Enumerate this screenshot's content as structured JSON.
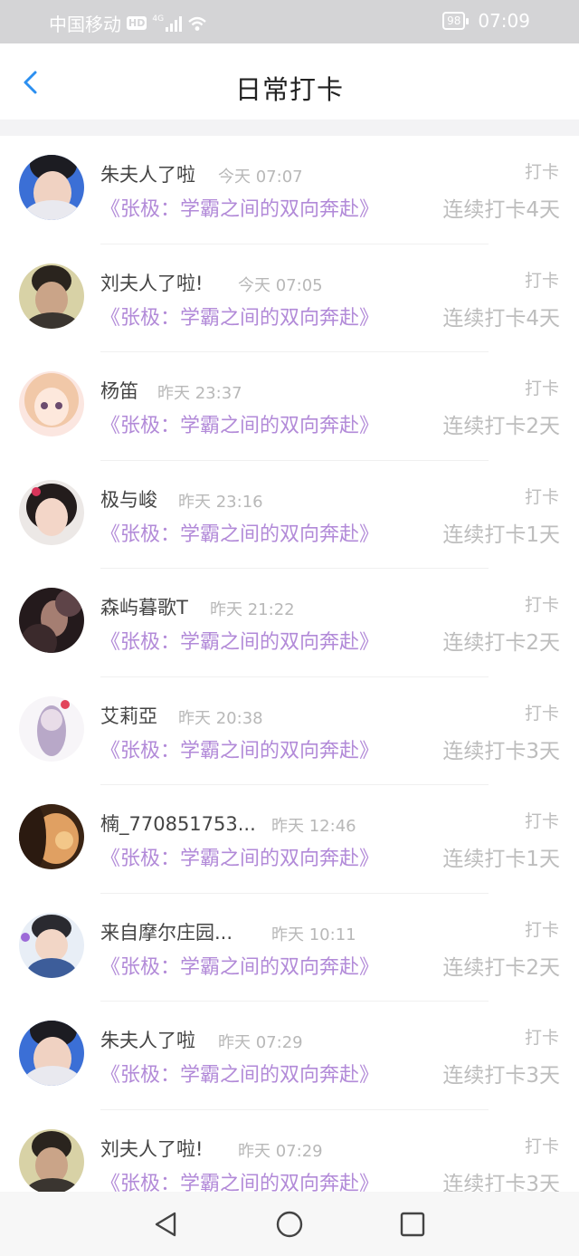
{
  "status_bar": {
    "carrier": "中国移动",
    "hd": "HD",
    "network": "4G",
    "battery": "98",
    "time": "07:09"
  },
  "header": {
    "title": "日常打卡",
    "back_icon": "chevron-left-icon"
  },
  "colors": {
    "accent_blue": "#2b8ff0",
    "book_purple": "#b28ad8",
    "muted_gray": "#bdbdbd",
    "status_bar_bg": "#d4d4d6"
  },
  "entries": [
    {
      "name": "朱夫人了啦",
      "time": "今天 07:07",
      "book": "《张极：学霸之间的双向奔赴》",
      "action": "打卡",
      "streak": "连续打卡4天"
    },
    {
      "name": "刘夫人了啦!",
      "time": "今天 07:05",
      "book": "《张极：学霸之间的双向奔赴》",
      "action": "打卡",
      "streak": "连续打卡4天"
    },
    {
      "name": "杨笛",
      "time": "昨天 23:37",
      "book": "《张极：学霸之间的双向奔赴》",
      "action": "打卡",
      "streak": "连续打卡2天"
    },
    {
      "name": "极与峻",
      "time": "昨天 23:16",
      "book": "《张极：学霸之间的双向奔赴》",
      "action": "打卡",
      "streak": "连续打卡1天"
    },
    {
      "name": "森屿暮歌T",
      "time": "昨天 21:22",
      "book": "《张极：学霸之间的双向奔赴》",
      "action": "打卡",
      "streak": "连续打卡2天"
    },
    {
      "name": "艾莉亞",
      "time": "昨天 20:38",
      "book": "《张极：学霸之间的双向奔赴》",
      "action": "打卡",
      "streak": "连续打卡3天"
    },
    {
      "name": "楠_770851753...",
      "time": "昨天 12:46",
      "book": "《张极：学霸之间的双向奔赴》",
      "action": "打卡",
      "streak": "连续打卡1天"
    },
    {
      "name": "来自摩尔庄园...",
      "time": "昨天 10:11",
      "book": "《张极：学霸之间的双向奔赴》",
      "action": "打卡",
      "streak": "连续打卡2天"
    },
    {
      "name": "朱夫人了啦",
      "time": "昨天 07:29",
      "book": "《张极：学霸之间的双向奔赴》",
      "action": "打卡",
      "streak": "连续打卡3天"
    },
    {
      "name": "刘夫人了啦!",
      "time": "昨天 07:29",
      "book": "《张极：学霸之间的双向奔赴》",
      "action": "打卡",
      "streak": "连续打卡3天"
    }
  ],
  "system_nav": {
    "back": "triangle-back-icon",
    "home": "circle-home-icon",
    "recent": "square-recent-icon"
  }
}
